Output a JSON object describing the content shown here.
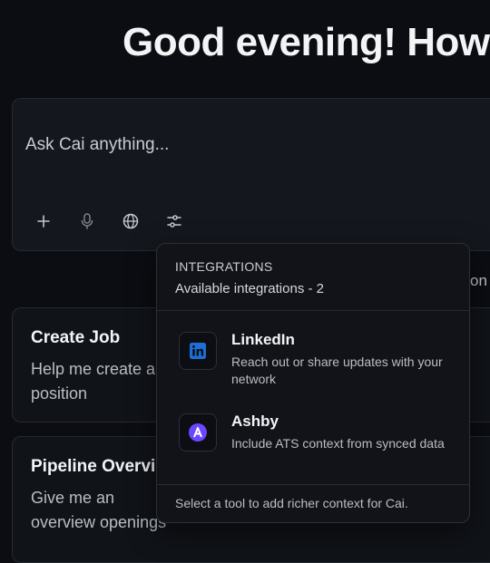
{
  "greeting": "Good evening! How",
  "composer": {
    "placeholder": "Ask Cai anything...",
    "tools": [
      {
        "name": "add",
        "icon": "plus-icon"
      },
      {
        "name": "voice",
        "icon": "microphone-icon"
      },
      {
        "name": "web",
        "icon": "globe-icon"
      },
      {
        "name": "integrations",
        "icon": "sliders-icon"
      }
    ]
  },
  "peek_text": "on",
  "cards": [
    {
      "title": "Create Job",
      "description": "Help me create a position"
    },
    {
      "title": "Pipeline Overview",
      "description": "Give me an overview openings"
    }
  ],
  "popover": {
    "heading": "INTEGRATIONS",
    "subheading": "Available integrations - 2",
    "items": [
      {
        "name": "LinkedIn",
        "description": "Reach out or share updates with your network",
        "icon": "linkedin-icon",
        "color": "#1d6fd6"
      },
      {
        "name": "Ashby",
        "description": "Include ATS context from synced data",
        "icon": "ashby-icon",
        "color": "#6c47ff"
      }
    ],
    "footer": "Select a tool to add richer context for Cai."
  }
}
